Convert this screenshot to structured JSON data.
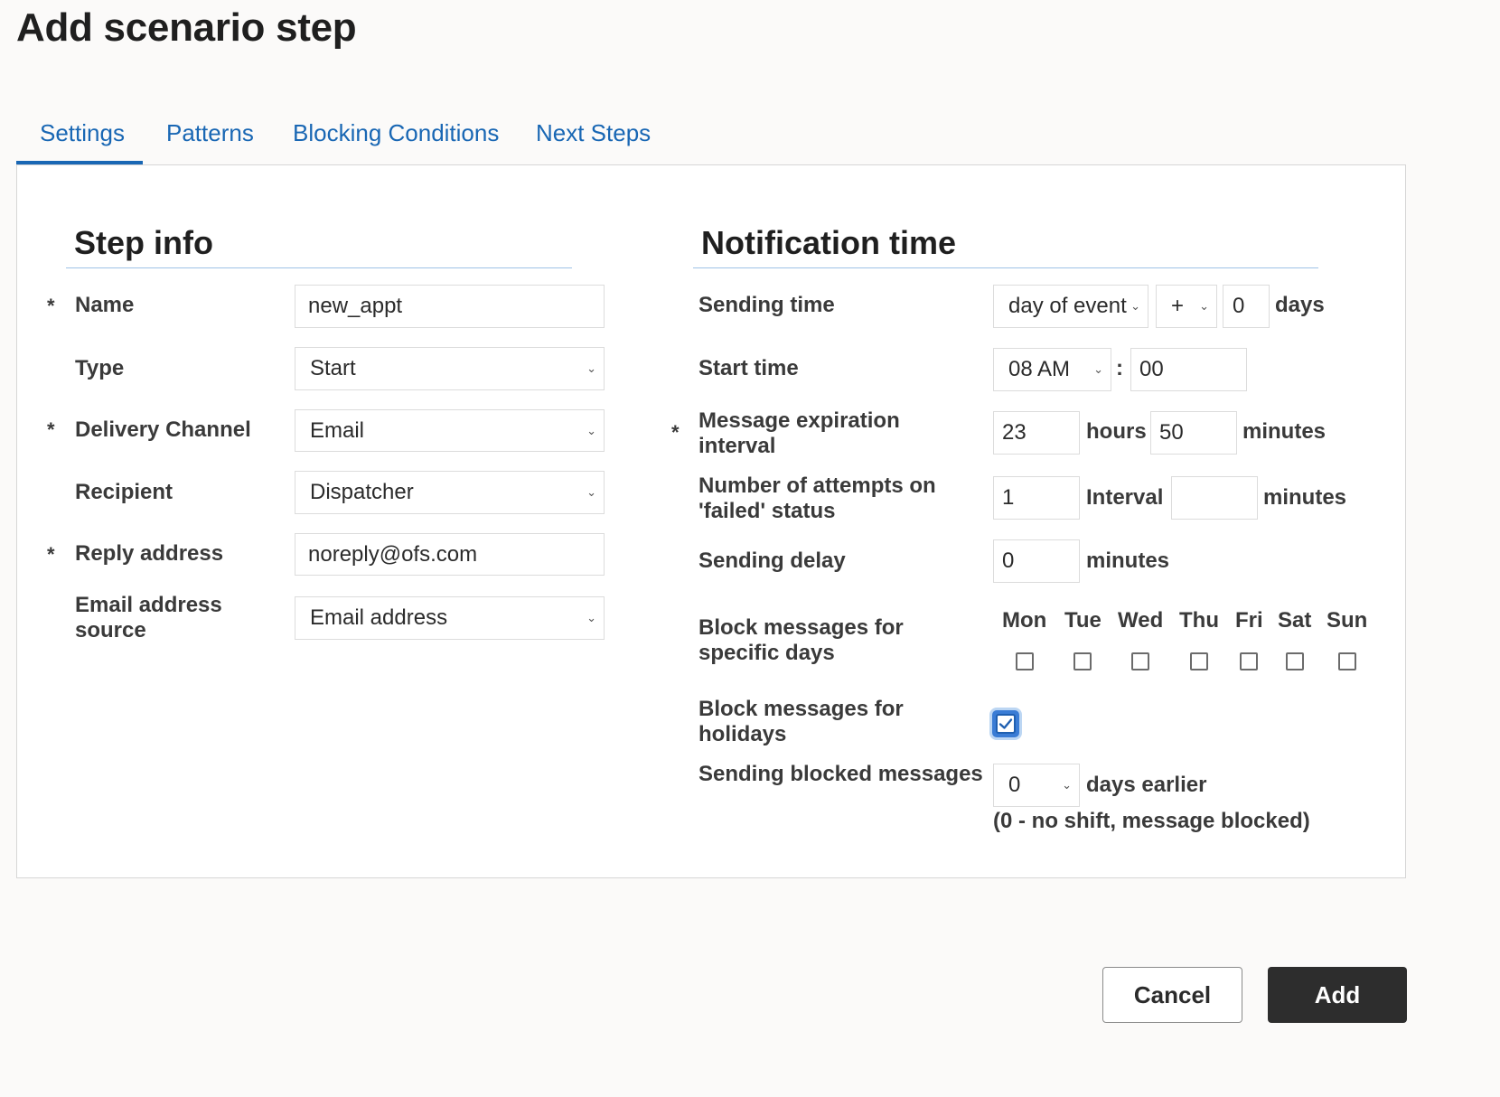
{
  "page_title": "Add scenario step",
  "tabs": [
    {
      "label": "Settings",
      "active": true
    },
    {
      "label": "Patterns",
      "active": false
    },
    {
      "label": "Blocking Conditions",
      "active": false
    },
    {
      "label": "Next Steps",
      "active": false
    }
  ],
  "required_mark": "*",
  "step_info": {
    "title": "Step info",
    "name": {
      "label": "Name",
      "value": "new_appt"
    },
    "type": {
      "label": "Type",
      "value": "Start"
    },
    "delivery_channel": {
      "label": "Delivery Channel",
      "value": "Email"
    },
    "recipient": {
      "label": "Recipient",
      "value": "Dispatcher"
    },
    "reply_address": {
      "label": "Reply address",
      "value": "noreply@ofs.com"
    },
    "email_source": {
      "label_line1": "Email address",
      "label_line2": "source",
      "value": "Email address"
    }
  },
  "notification_time": {
    "title": "Notification time",
    "sending_time": {
      "label": "Sending time",
      "base": "day of event",
      "sign": "+",
      "offset": "0",
      "unit": "days"
    },
    "start_time": {
      "label": "Start time",
      "hour": "08 AM",
      "separator": ":",
      "minute": "00"
    },
    "expiration": {
      "label_line1": "Message expiration",
      "label_line2": "interval",
      "hours": "23",
      "hours_unit": "hours",
      "minutes": "50",
      "minutes_unit": "minutes"
    },
    "attempts": {
      "label_line1": "Number of attempts on",
      "label_line2": "'failed' status",
      "value": "1",
      "interval_label": "Interval",
      "interval_value": "",
      "interval_unit": "minutes"
    },
    "sending_delay": {
      "label": "Sending delay",
      "value": "0",
      "unit": "minutes"
    },
    "block_days": {
      "label_line1": "Block messages for",
      "label_line2": "specific days",
      "days": [
        {
          "label": "Mon",
          "checked": false
        },
        {
          "label": "Tue",
          "checked": false
        },
        {
          "label": "Wed",
          "checked": false
        },
        {
          "label": "Thu",
          "checked": false
        },
        {
          "label": "Fri",
          "checked": false
        },
        {
          "label": "Sat",
          "checked": false
        },
        {
          "label": "Sun",
          "checked": false
        }
      ]
    },
    "block_holidays": {
      "label_line1": "Block messages for",
      "label_line2": "holidays",
      "checked": true
    },
    "blocked_sending": {
      "label": "Sending blocked messages",
      "value": "0",
      "unit": "days earlier",
      "note": "(0 - no shift, message blocked)"
    }
  },
  "buttons": {
    "cancel": "Cancel",
    "add": "Add"
  },
  "colors": {
    "accent": "#1967b4",
    "primary_button": "#2d2d2d",
    "section_rule": "#9ec3e6",
    "checkbox_checked": "#3a7cd5"
  }
}
